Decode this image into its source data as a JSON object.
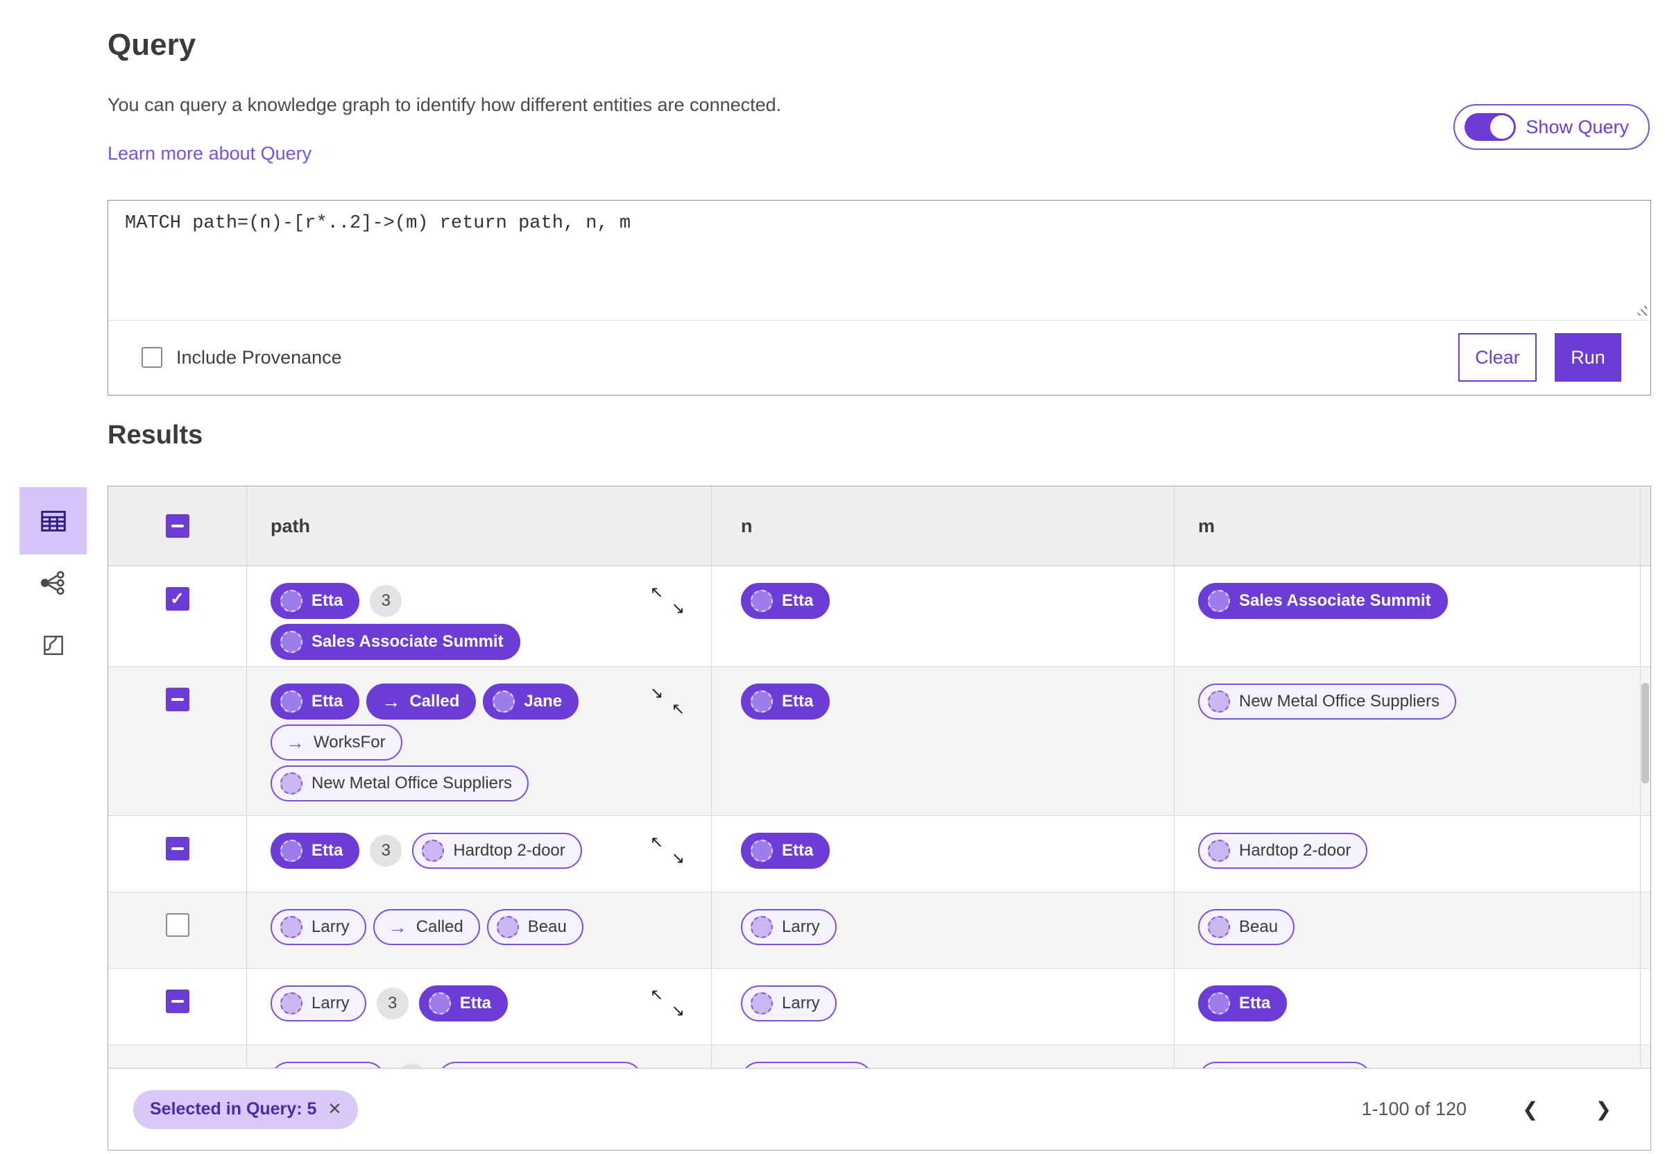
{
  "colors": {
    "accent": "#6B3CD6",
    "accent_border": "#7A4FE0",
    "accent_light": "#D9C8F8",
    "link": "#7852DD",
    "count_badge_bg": "#E3E3E3"
  },
  "glyphs": {
    "check": "✓",
    "close": "✕",
    "edge_arrow": "→",
    "expand": [
      "↖",
      "↘"
    ],
    "collapse": [
      "↘",
      "↖"
    ],
    "prev": "❮",
    "next": "❯"
  },
  "header": {
    "title": "Query",
    "description": "You can query a knowledge graph to identify how different entities are connected.",
    "learn_more": "Learn more about Query",
    "show_query_label": "Show Query",
    "show_query_state": "on"
  },
  "query_panel": {
    "query_text": "MATCH path=(n)-[r*..2]->(m) return path, n, m",
    "include_provenance_label": "Include Provenance",
    "include_provenance_checked": false,
    "clear_label": "Clear",
    "run_label": "Run"
  },
  "results": {
    "title": "Results",
    "view_modes": [
      "table-view",
      "graph-view",
      "map-view"
    ],
    "selected_view": "table-view",
    "columns": [
      "path",
      "n",
      "m"
    ],
    "rows": [
      {
        "checkbox": "checked",
        "expand_icon": "expand",
        "path_lines": [
          [
            {
              "kind": "node",
              "variant": "filled",
              "label": "Etta"
            },
            {
              "kind": "count",
              "label": "3"
            }
          ],
          [
            {
              "kind": "node",
              "variant": "filled",
              "label": "Sales Associate Summit"
            }
          ]
        ],
        "n": {
          "kind": "node",
          "variant": "filled",
          "label": "Etta"
        },
        "m": {
          "kind": "node",
          "variant": "filled",
          "label": "Sales Associate Summit"
        }
      },
      {
        "checkbox": "indeterminate",
        "expand_icon": "collapse",
        "path_lines": [
          [
            {
              "kind": "node",
              "variant": "filled",
              "label": "Etta"
            },
            {
              "kind": "edge",
              "variant": "filled",
              "label": "Called"
            },
            {
              "kind": "node",
              "variant": "filled",
              "label": "Jane"
            }
          ],
          [
            {
              "kind": "edge",
              "variant": "outline",
              "label": "WorksFor"
            }
          ],
          [
            {
              "kind": "node",
              "variant": "outline",
              "label": "New Metal Office Suppliers"
            }
          ]
        ],
        "n": {
          "kind": "node",
          "variant": "filled",
          "label": "Etta"
        },
        "m": {
          "kind": "node",
          "variant": "outline",
          "label": "New Metal Office Suppliers"
        }
      },
      {
        "checkbox": "indeterminate",
        "expand_icon": "expand",
        "path_lines": [
          [
            {
              "kind": "node",
              "variant": "filled",
              "label": "Etta"
            },
            {
              "kind": "count",
              "label": "3"
            },
            {
              "kind": "node",
              "variant": "outline",
              "label": "Hardtop 2-door"
            }
          ]
        ],
        "n": {
          "kind": "node",
          "variant": "filled",
          "label": "Etta"
        },
        "m": {
          "kind": "node",
          "variant": "outline",
          "label": "Hardtop 2-door"
        }
      },
      {
        "checkbox": "unchecked",
        "expand_icon": null,
        "path_lines": [
          [
            {
              "kind": "node",
              "variant": "outline",
              "label": "Larry"
            },
            {
              "kind": "edge",
              "variant": "outline",
              "label": "Called"
            },
            {
              "kind": "node",
              "variant": "outline",
              "label": "Beau"
            }
          ]
        ],
        "n": {
          "kind": "node",
          "variant": "outline",
          "label": "Larry"
        },
        "m": {
          "kind": "node",
          "variant": "outline",
          "label": "Beau"
        }
      },
      {
        "checkbox": "indeterminate",
        "expand_icon": "expand",
        "path_lines": [
          [
            {
              "kind": "node",
              "variant": "outline",
              "label": "Larry"
            },
            {
              "kind": "count",
              "label": "3"
            },
            {
              "kind": "node",
              "variant": "filled",
              "label": "Etta"
            }
          ]
        ],
        "n": {
          "kind": "node",
          "variant": "outline",
          "label": "Larry"
        },
        "m": {
          "kind": "node",
          "variant": "filled",
          "label": "Etta"
        }
      },
      {
        "checkbox": "none",
        "expand_icon": null,
        "partial": true,
        "path_lines": [
          [
            {
              "kind": "node",
              "variant": "outline",
              "label": ""
            },
            {
              "kind": "count",
              "label": ""
            },
            {
              "kind": "node",
              "variant": "outline",
              "label": ""
            }
          ]
        ],
        "n": {
          "kind": "node",
          "variant": "outline",
          "label": ""
        },
        "m": {
          "kind": "node",
          "variant": "outline",
          "label": ""
        }
      }
    ],
    "footer": {
      "selected_chip": "Selected in Query: 5",
      "pagination": "1-100 of 120"
    }
  }
}
